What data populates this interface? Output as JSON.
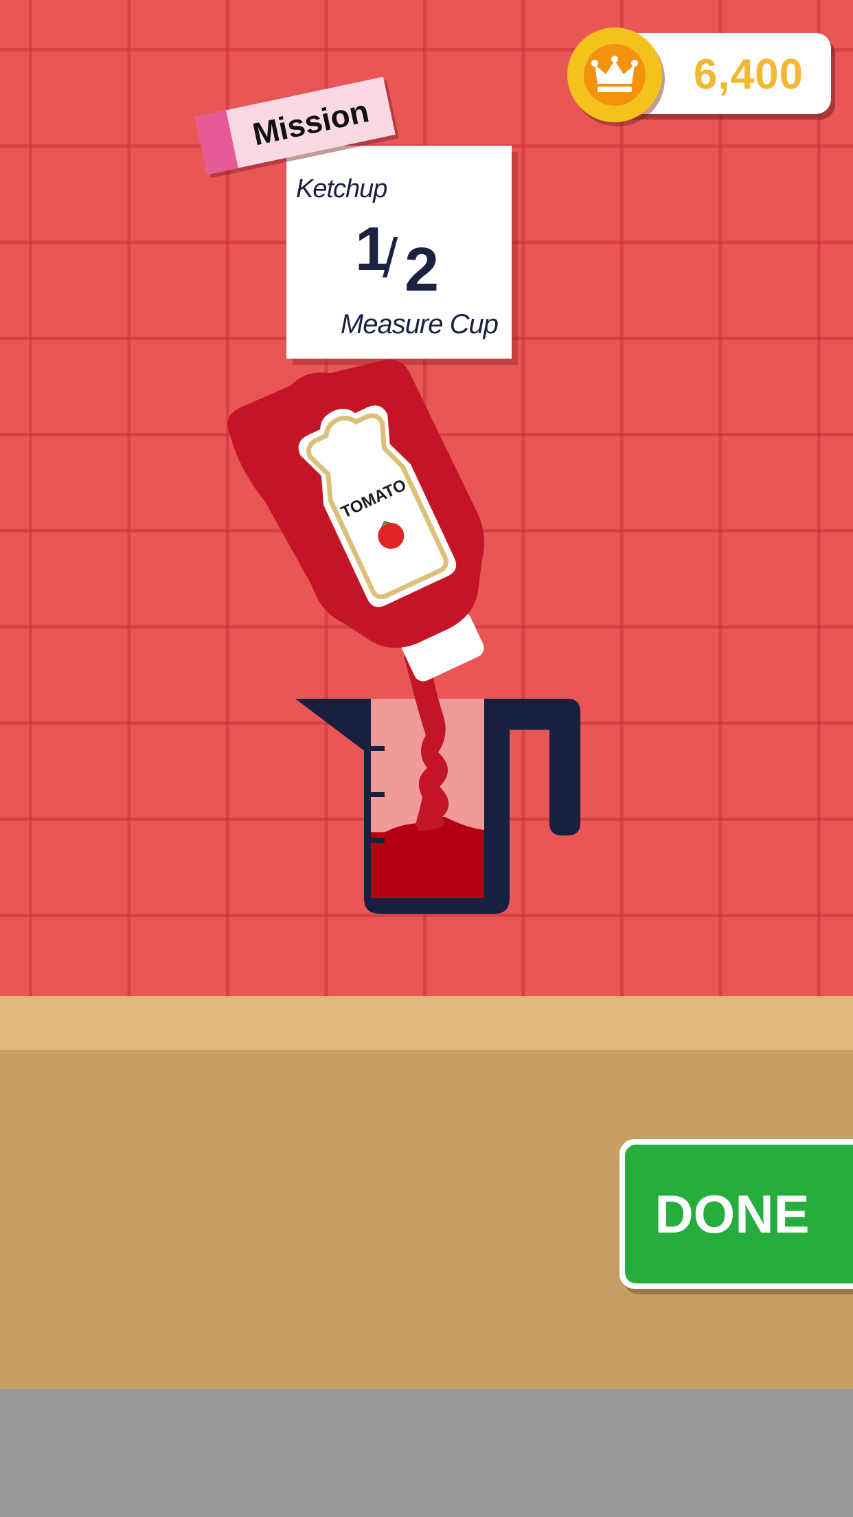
{
  "hud": {
    "coins": "6,400",
    "coin_icon": "crown-coin-icon"
  },
  "mission": {
    "tag": "Mission",
    "ingredient": "Ketchup",
    "amount_numerator": "1",
    "amount_denominator": "2",
    "unit": "Measure Cup"
  },
  "scene": {
    "bottle_label": "TOMATO",
    "cup_fill_fraction": 0.33
  },
  "actions": {
    "done_label": "DONE"
  },
  "colors": {
    "wall": "#e85656",
    "ketchup": "#c41527",
    "cup": "#17203f",
    "done_button": "#27ad3e",
    "coin": "#f5c21b",
    "counter": "#c89f63"
  }
}
